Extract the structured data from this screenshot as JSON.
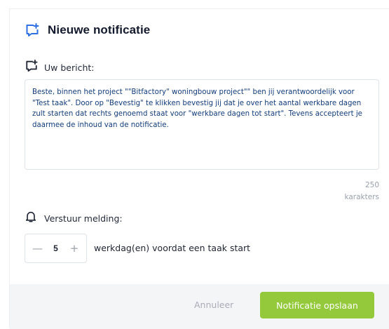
{
  "modal": {
    "title": "Nieuwe notificatie",
    "message_label": "Uw bericht:",
    "message_text": "Beste, binnen het project \"\"Bitfactory\" woningbouw project\"\" ben jij verantwoordelijk voor \"Test taak\". Door op \"Bevestig\" te klikken bevestig jij dat je over het aantal werkbare dagen zult starten dat rechts genoemd staat voor \"werkbare dagen tot start\". Tevens accepteert je daarmee de inhoud van de notificatie.",
    "char_count": "250",
    "char_unit": "karakters",
    "notify_label": "Verstuur melding:",
    "stepper": {
      "minus": "—",
      "value": "5",
      "plus": "+",
      "suffix": "werkdag(en) voordat een taak start"
    },
    "footer": {
      "cancel_label": "Annuleer",
      "save_label": "Notificatie opslaan"
    }
  },
  "colors": {
    "accent_blue": "#2f6fe4",
    "save_green": "#93c93b",
    "message_text": "#123c7a",
    "footer_bg": "#f4f5f7"
  },
  "icons": {
    "title_icon": "message-plus-icon",
    "message_icon": "message-plus-icon",
    "notify_icon": "bell-icon"
  }
}
